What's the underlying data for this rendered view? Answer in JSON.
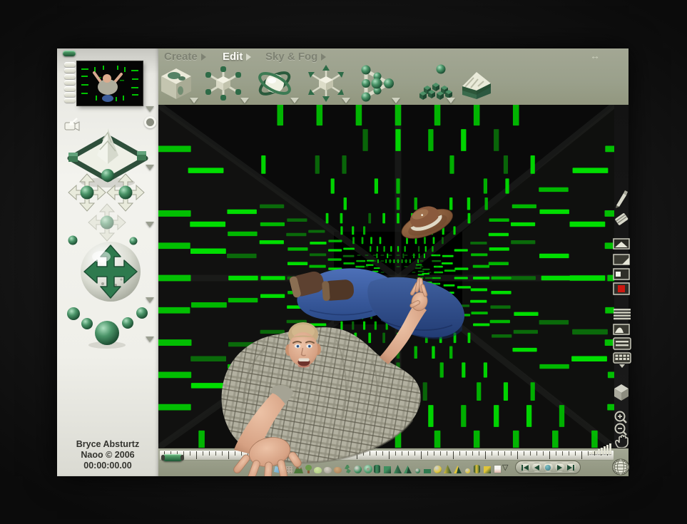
{
  "colors": {
    "sage": "#9ba08c",
    "matrix_green": "#00d400",
    "bryce_green": "#2f7a4f",
    "record_teal": "#4f949b",
    "render_red": "#cc1810"
  },
  "top_menu": {
    "items": [
      "Create",
      "Edit",
      "Sky & Fog"
    ],
    "active": "Edit",
    "expander_glyph": "↔"
  },
  "create_toolbar": {
    "tools": [
      {
        "name": "textured-cube-tool"
      },
      {
        "name": "resize-tool"
      },
      {
        "name": "rotate-tool"
      },
      {
        "name": "reposition-tool"
      },
      {
        "name": "align-tool"
      },
      {
        "name": "disperse-tool"
      },
      {
        "name": "terrain-editor-tool"
      }
    ]
  },
  "sidebar": {
    "controls": [
      "preset-pills",
      "render-preview",
      "camera-mode",
      "camera-target",
      "camera-cross-control",
      "pan-control-left",
      "pan-control-right",
      "pan-control-ghost",
      "camera-trackball",
      "view-preset-spheres"
    ]
  },
  "credits": {
    "artist": "Bryce Absturtz",
    "copyright": "Naoo © 2006",
    "timecode": "00:00:00.00"
  },
  "right_toolbar": {
    "tools": [
      "pencil",
      "eraser",
      "render-region",
      "page-flip",
      "render-small",
      "render",
      "line-stack",
      "curve-panel",
      "text-panel",
      "keyboard-panel",
      "solo-cube",
      "zoom-in",
      "zoom-out",
      "pan-hand"
    ]
  },
  "bottom_palette": {
    "more_glyph": "▽",
    "items": [
      {
        "name": "water-plane",
        "shape": "water",
        "color": "#5f9ec6"
      },
      {
        "name": "stone-plane",
        "shape": "stone",
        "color": "#b7ac9c"
      },
      {
        "name": "terrain",
        "shape": "terrain",
        "color": "#4c7a3a"
      },
      {
        "name": "tree",
        "shape": "tree",
        "color": "#6b9a4a"
      },
      {
        "name": "bush",
        "shape": "bush",
        "color": "#a8c77a"
      },
      {
        "name": "rock",
        "shape": "rock",
        "color": "#9a958a"
      },
      {
        "name": "boulder",
        "shape": "boulder",
        "color": "#a07a52"
      },
      {
        "name": "branch",
        "shape": "branch",
        "color": "#4a8a5a"
      },
      {
        "name": "sphere",
        "shape": "sphere",
        "color": "#3f8f5f"
      },
      {
        "name": "torus",
        "shape": "torus",
        "color": "#3f8f5f"
      },
      {
        "name": "cylinder",
        "shape": "cylinder",
        "color": "#3f8f5f"
      },
      {
        "name": "cube",
        "shape": "cube",
        "color": "#3f8f5f"
      },
      {
        "name": "cone",
        "shape": "cone",
        "color": "#3f8f5f"
      },
      {
        "name": "pyramid",
        "shape": "pyramid",
        "color": "#3f8f5f"
      },
      {
        "name": "small-sphere",
        "shape": "dot",
        "color": "#2f7a4f"
      },
      {
        "name": "flat-cube",
        "shape": "flat",
        "color": "#2f7a4f"
      },
      {
        "name": "yellow-sphere",
        "shape": "sphere",
        "color": "#e0c53a"
      },
      {
        "name": "yellow-wedge",
        "shape": "cone",
        "color": "#e0c53a"
      },
      {
        "name": "yellow-cone",
        "shape": "pyramid",
        "color": "#e0c53a"
      },
      {
        "name": "yellow-ball",
        "shape": "dot",
        "color": "#e0c53a"
      },
      {
        "name": "yellow-cylinder",
        "shape": "cylinder",
        "color": "#e0c53a"
      },
      {
        "name": "yellow-cube",
        "shape": "cube",
        "color": "#e0c53a"
      },
      {
        "name": "picture-panel",
        "shape": "panel",
        "color": "#e3b9ac"
      }
    ]
  },
  "transport": {
    "buttons": [
      {
        "name": "step-backward-button",
        "glyph": "step-back"
      },
      {
        "name": "play-backward-button",
        "glyph": "back"
      },
      {
        "name": "record-button",
        "glyph": "dot"
      },
      {
        "name": "play-forward-button",
        "glyph": "play"
      },
      {
        "name": "step-forward-button",
        "glyph": "step-forward"
      }
    ]
  },
  "scene": {
    "subject": "falling-man",
    "prop": "cowboy-hat",
    "environment": "matrix-green-tunnel"
  }
}
